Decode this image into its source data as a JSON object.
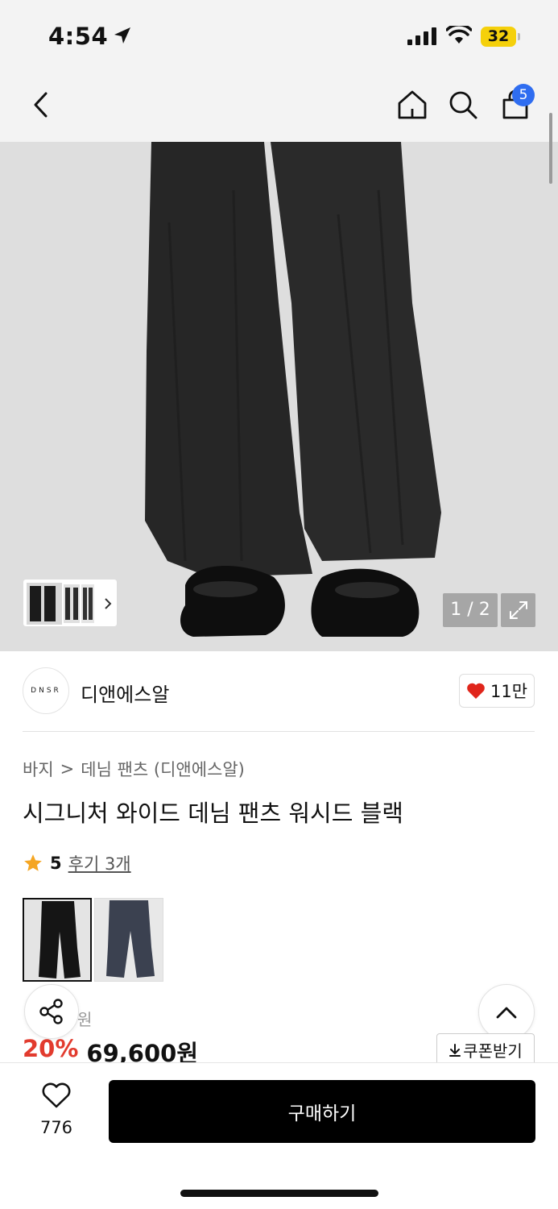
{
  "status_bar": {
    "time": "4:54",
    "battery": "32"
  },
  "header": {
    "cart_count": "5"
  },
  "gallery": {
    "counter": "1 / 2"
  },
  "brand": {
    "logo_text": "DNSR",
    "name": "디앤에스알",
    "likes": "11만"
  },
  "breadcrumb": {
    "category": "바지",
    "separator": ">",
    "subcategory": "데님 팬츠 (디앤에스알)"
  },
  "product": {
    "title": "시그니처 와이드 데님 팬츠 워시드 블랙",
    "rating": "5",
    "reviews": "후기 3개",
    "original_price_suffix": "원",
    "discount": "20%",
    "price": "69,600원",
    "coupon_label": "쿠폰받기"
  },
  "bottom_bar": {
    "wish_count": "776",
    "buy_label": "구매하기"
  },
  "colors": {
    "accent_red": "#e23b2e",
    "badge_blue": "#2f6df0",
    "buy_button": "#000000"
  }
}
